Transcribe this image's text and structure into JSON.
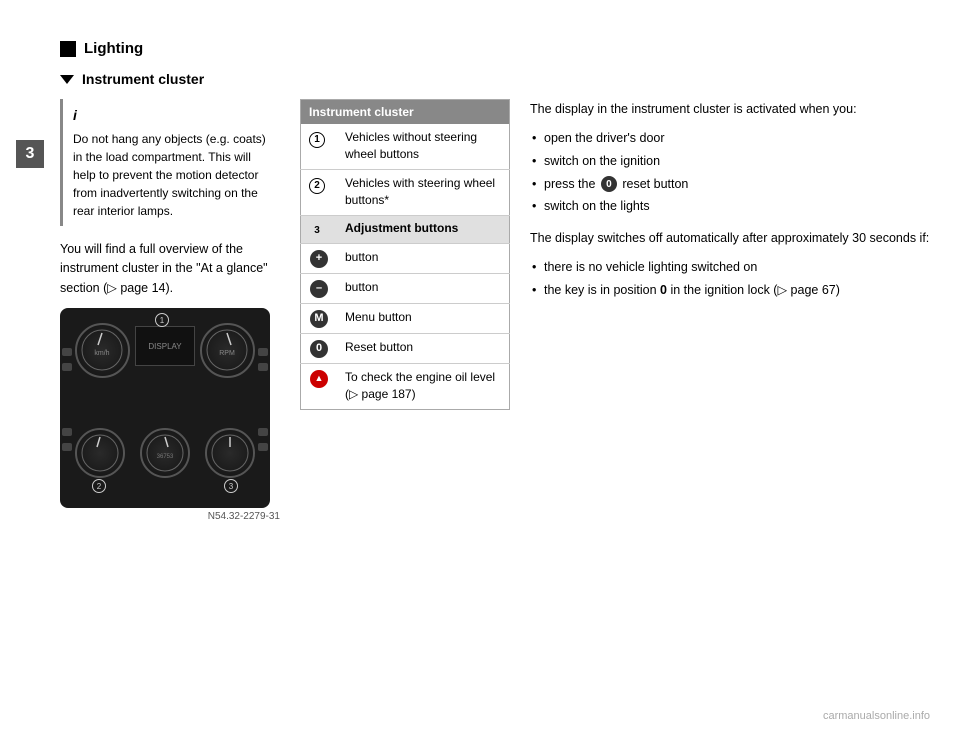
{
  "page": {
    "chapter_number": "3",
    "section": {
      "title": "Lighting",
      "subsection_title": "Instrument cluster"
    }
  },
  "info_box": {
    "icon": "i",
    "text": "Do not hang any objects (e.g. coats) in the load compartment. This will help to prevent the motion detector from inadvertently switching on the rear interior lamps."
  },
  "body_text": "You will find a full overview of the instrument cluster in the \"At a glance\" section (▷ page 14).",
  "cluster_caption": "N54.32-2279-31",
  "table": {
    "header": "Instrument cluster",
    "rows": [
      {
        "num": "1",
        "text": "Vehicles without steering wheel buttons"
      },
      {
        "num": "2",
        "text": "Vehicles with steering wheel buttons*"
      },
      {
        "section_label": "Adjustment buttons"
      },
      {
        "btn": "+",
        "btn_type": "plus",
        "text": "button"
      },
      {
        "btn": "–",
        "btn_type": "minus",
        "text": "button"
      },
      {
        "btn": "M",
        "btn_type": "menu",
        "text": "Menu button"
      },
      {
        "btn": "0",
        "btn_type": "reset",
        "text": "Reset button"
      },
      {
        "btn": "▲",
        "btn_type": "oil",
        "text": "To check the engine oil level (▷ page 187)"
      }
    ]
  },
  "right_column": {
    "intro": "The display in the instrument cluster is activated when you:",
    "activation_bullets": [
      "open the driver's door",
      "switch on the ignition",
      "press the  reset button",
      "switch on the lights"
    ],
    "switches_off_intro": "The display switches off automatically after approximately 30 seconds if:",
    "switches_off_bullets": [
      "there is no vehicle lighting switched on",
      "the key is in position 0 in the ignition lock (▷ page 67)"
    ]
  },
  "footer": "carmanualsonline.info"
}
